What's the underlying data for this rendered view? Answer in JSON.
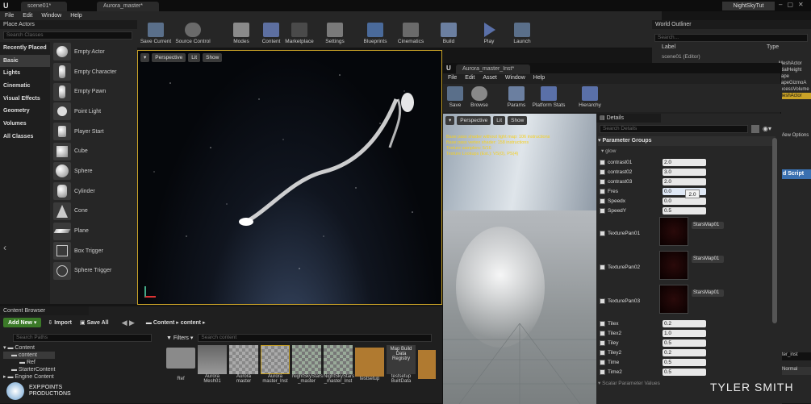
{
  "titlebar": {
    "tab1": "scene01*",
    "tab2": "Aurora_master*",
    "app_tag": "NightSkyTut"
  },
  "menu": [
    "File",
    "Edit",
    "Window",
    "Help"
  ],
  "toolbar": {
    "buttons": [
      "Save Current",
      "Source Control",
      "Modes",
      "Content",
      "Marketplace",
      "Settings",
      "Blueprints",
      "Cinematics",
      "Build",
      "Play",
      "Launch"
    ]
  },
  "place_actors": {
    "title": "Place Actors",
    "search": "Search Classes",
    "categories": [
      "Recently Placed",
      "Basic",
      "Lights",
      "Cinematic",
      "Visual Effects",
      "Geometry",
      "Volumes",
      "All Classes"
    ],
    "items": [
      "Empty Actor",
      "Empty Character",
      "Empty Pawn",
      "Point Light",
      "Player Start",
      "Cube",
      "Sphere",
      "Cylinder",
      "Cone",
      "Plane",
      "Box Trigger",
      "Sphere Trigger"
    ]
  },
  "viewport": {
    "perspective": "Perspective",
    "lit": "Lit",
    "show": "Show"
  },
  "content_browser": {
    "title": "Content Browser",
    "add_new": "Add New",
    "import": "Import",
    "save_all": "Save All",
    "path_root": "Content",
    "path_sub": "content",
    "search_paths": "Search Paths",
    "filters": "Filters",
    "search_content": "Search content",
    "tree": [
      "Content",
      "content",
      "Ref",
      "StarterContent",
      "Engine Content"
    ],
    "assets": [
      "Ref",
      "Aurora Mesh01",
      "Aurora master",
      "Aurora master_Inst",
      "NightSkyStars _master",
      "NightSkyStars _master_Inst",
      "testsetup",
      "Map Build Data Registry",
      "testsetup BuiltData",
      ""
    ]
  },
  "outliner": {
    "title": "World Outliner",
    "search": "Search...",
    "col_label": "Label",
    "col_type": "Type",
    "row": "scene01 (Editor)"
  },
  "right_side": {
    "types": [
      "MeshActor",
      "ntialHeight",
      "cape",
      "capeGizmoA",
      "rocessVolume",
      "MeshActor"
    ],
    "view_options": "View Options",
    "add_script": "d Script",
    "inst_name": "ter_inst",
    "normal": "Normal"
  },
  "material_editor": {
    "tab": "Aurora_master_Inst*",
    "menu": [
      "File",
      "Edit",
      "Asset",
      "Window",
      "Help"
    ],
    "toolbar": [
      "Save",
      "Browse",
      "Params",
      "Platform Stats",
      "Hierarchy"
    ],
    "viewport": {
      "perspective": "Perspective",
      "lit": "Lit",
      "show": "Show",
      "stats": [
        "Base pass shader without light map: 106 instructions",
        "Base pass vertex shader: 158 instructions",
        "Texture samplers: 5/16",
        "Texture Lookups (Est.): VS(0), PS(4)"
      ]
    },
    "details": {
      "title": "Details",
      "search": "Search Details",
      "group": "Parameter Groups",
      "subgroup": "glow",
      "tooltip": "2.0",
      "params": [
        {
          "name": "contrast01",
          "value": "2.0"
        },
        {
          "name": "contrast02",
          "value": "3.0"
        },
        {
          "name": "contrast03",
          "value": "2.0"
        },
        {
          "name": "Fres",
          "value": "0.0"
        },
        {
          "name": "Speedx",
          "value": "0.0"
        },
        {
          "name": "SpeedY",
          "value": "0.5"
        }
      ],
      "textures": [
        {
          "name": "TexturePan01",
          "asset": "StarsMap01"
        },
        {
          "name": "TexturePan02",
          "asset": "StarsMap01"
        },
        {
          "name": "TexturePan03",
          "asset": "StarsMap01"
        }
      ],
      "params2": [
        {
          "name": "Tilex",
          "value": "0.2"
        },
        {
          "name": "Tilex2",
          "value": "1.0"
        },
        {
          "name": "Tiley",
          "value": "0.5"
        },
        {
          "name": "Tiley2",
          "value": "0.2"
        },
        {
          "name": "Time",
          "value": "0.5"
        },
        {
          "name": "Time2",
          "value": "0.5"
        }
      ],
      "footer": "Scalar Parameter Values"
    }
  },
  "watermark": {
    "left1": "EXP.POINTS",
    "left2": "PRODUCTIONS",
    "right": "TYLER SMITH"
  },
  "colors": {
    "accent": "#c9a227",
    "panel": "#262626",
    "addnew": "#3b7a28"
  }
}
